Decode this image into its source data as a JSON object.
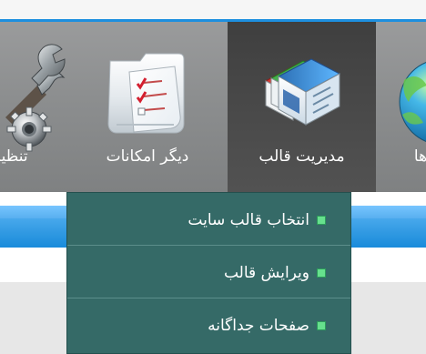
{
  "theme": {
    "accent_blue": "#1d8fdf",
    "nav_background": "#8c8e8f",
    "nav_active_background": "#474747",
    "submenu_background": "#356a67",
    "submenu_bullet": "#66e08d"
  },
  "navigation": {
    "items": [
      {
        "label": "تنظیم",
        "icon": "wrench-gear-icon"
      },
      {
        "label": "دیگر امکانات",
        "icon": "folder-checklist-icon"
      },
      {
        "label": "مدیریت قالب",
        "icon": "theme-windows-icon",
        "active": true
      },
      {
        "label": "ها",
        "icon": "globe-icon"
      }
    ]
  },
  "submenu": {
    "items": [
      {
        "label": "انتخاب قالب سایت",
        "bullet": "green-square-icon"
      },
      {
        "label": "ویرایش قالب",
        "bullet": "green-square-icon"
      },
      {
        "label": "صفحات جداگانه",
        "bullet": "green-square-icon"
      }
    ]
  }
}
